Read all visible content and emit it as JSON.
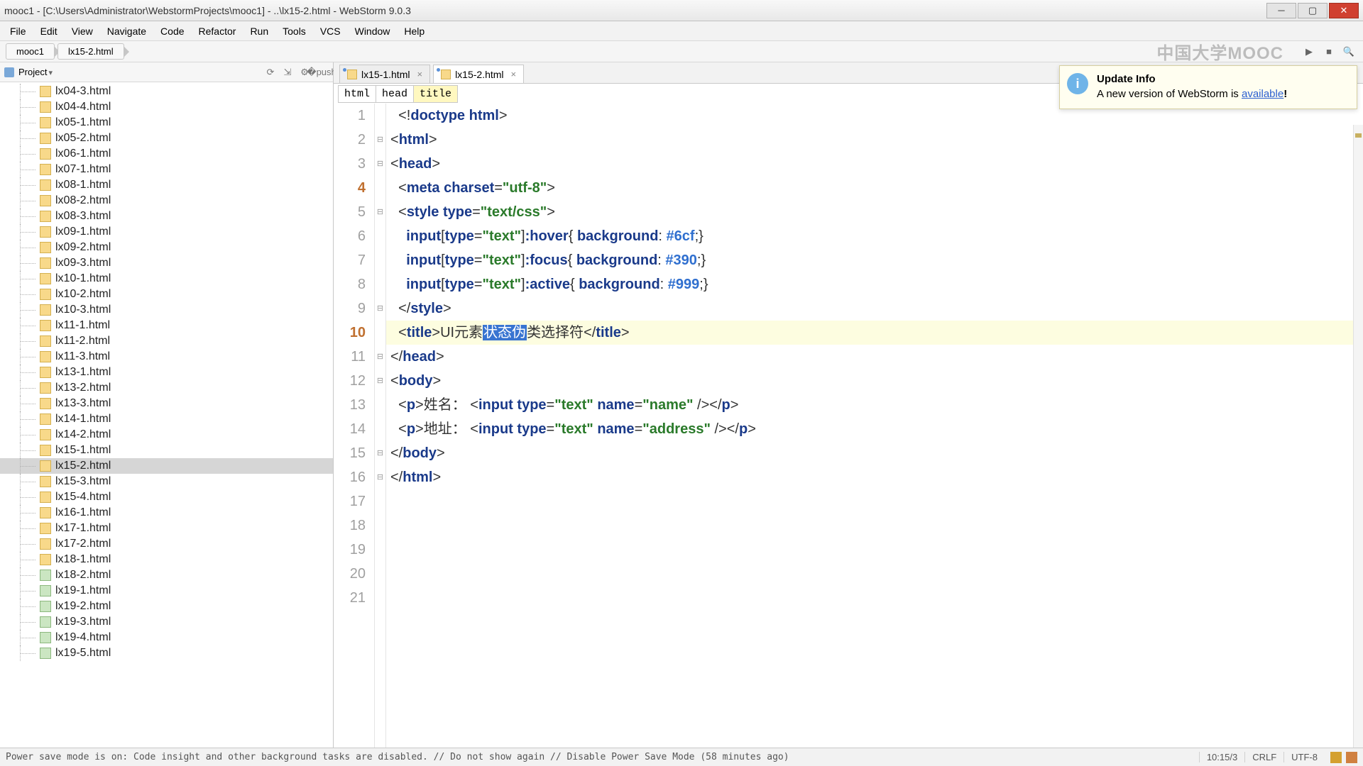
{
  "window": {
    "title": "mooc1 - [C:\\Users\\Administrator\\WebstormProjects\\mooc1] - ..\\lx15-2.html - WebStorm 9.0.3"
  },
  "menu": [
    "File",
    "Edit",
    "View",
    "Navigate",
    "Code",
    "Refactor",
    "Run",
    "Tools",
    "VCS",
    "Window",
    "Help"
  ],
  "breadcrumbs": [
    "mooc1",
    "lx15-2.html"
  ],
  "watermark": "中国大学MOOC",
  "project": {
    "title": "Project",
    "files": [
      {
        "name": "lx04-3.html"
      },
      {
        "name": "lx04-4.html"
      },
      {
        "name": "lx05-1.html"
      },
      {
        "name": "lx05-2.html"
      },
      {
        "name": "lx06-1.html"
      },
      {
        "name": "lx07-1.html"
      },
      {
        "name": "lx08-1.html"
      },
      {
        "name": "lx08-2.html"
      },
      {
        "name": "lx08-3.html"
      },
      {
        "name": "lx09-1.html"
      },
      {
        "name": "lx09-2.html"
      },
      {
        "name": "lx09-3.html"
      },
      {
        "name": "lx10-1.html"
      },
      {
        "name": "lx10-2.html"
      },
      {
        "name": "lx10-3.html"
      },
      {
        "name": "lx11-1.html"
      },
      {
        "name": "lx11-2.html"
      },
      {
        "name": "lx11-3.html"
      },
      {
        "name": "lx13-1.html"
      },
      {
        "name": "lx13-2.html"
      },
      {
        "name": "lx13-3.html"
      },
      {
        "name": "lx14-1.html"
      },
      {
        "name": "lx14-2.html"
      },
      {
        "name": "lx15-1.html"
      },
      {
        "name": "lx15-2.html",
        "selected": true
      },
      {
        "name": "lx15-3.html"
      },
      {
        "name": "lx15-4.html"
      },
      {
        "name": "lx16-1.html"
      },
      {
        "name": "lx17-1.html"
      },
      {
        "name": "lx17-2.html"
      },
      {
        "name": "lx18-1.html"
      },
      {
        "name": "lx18-2.html",
        "alt": true
      },
      {
        "name": "lx19-1.html",
        "alt": true
      },
      {
        "name": "lx19-2.html",
        "alt": true
      },
      {
        "name": "lx19-3.html",
        "alt": true
      },
      {
        "name": "lx19-4.html",
        "alt": true
      },
      {
        "name": "lx19-5.html",
        "alt": true
      }
    ]
  },
  "tabs": [
    {
      "label": "lx15-1.html",
      "active": false
    },
    {
      "label": "lx15-2.html",
      "active": true
    }
  ],
  "pathCrumbs": [
    "html",
    "head",
    "title"
  ],
  "code": {
    "lineCount": 21,
    "highlightLine": 10,
    "changedLines": [
      4,
      10
    ],
    "foldable": [
      2,
      3,
      5,
      9,
      11,
      12,
      15,
      16
    ],
    "title_before": "UI元素",
    "title_sel": "状态伪",
    "title_after": "类选择符",
    "hover_color": "#6cf",
    "focus_color": "#390",
    "active_color": "#999",
    "label_name": "姓名：",
    "label_addr": "地址：",
    "name_attr": "name",
    "addr_attr": "address"
  },
  "notification": {
    "title": "Update Info",
    "body_pre": "A new version of WebStorm is ",
    "body_link": "available",
    "body_post": "!"
  },
  "status": {
    "message": "Power save mode is on: Code insight and other background tasks are disabled. // Do not show again // Disable Power Save Mode (58 minutes ago)",
    "pos": "10:15/3",
    "eol": "CRLF",
    "enc": "UTF-8"
  }
}
